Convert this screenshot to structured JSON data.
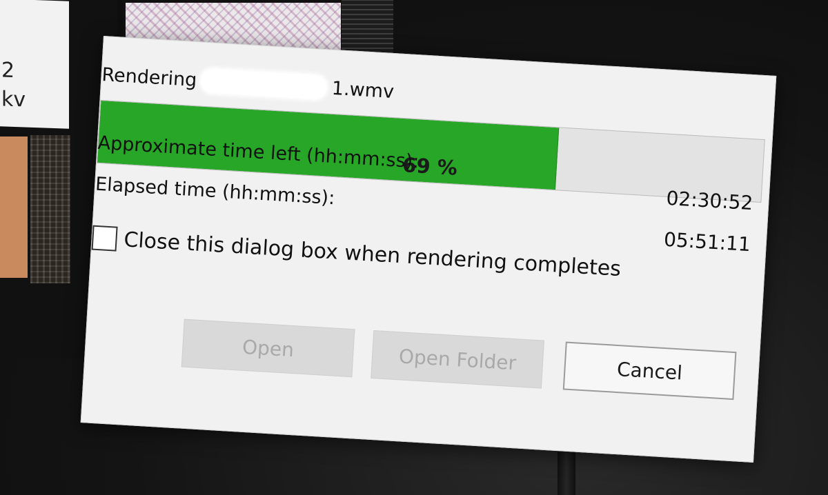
{
  "dialog": {
    "title_prefix": "Rendering",
    "title_suffix": "1.wmv"
  },
  "progress": {
    "percent": 69,
    "label": "69 %",
    "fill_color": "#28a628"
  },
  "time_remaining": {
    "label": "Approximate time left (hh:mm:ss):",
    "value": "02:30:52"
  },
  "time_elapsed": {
    "label": "Elapsed time (hh:mm:ss):",
    "value": "05:51:11"
  },
  "close_option": {
    "label": "Close this dialog box when rendering completes",
    "checked": false
  },
  "buttons": {
    "open": "Open",
    "open_folder": "Open Folder",
    "cancel": "Cancel"
  },
  "background": {
    "thumb_text_line1": "2",
    "thumb_text_line2": "kv"
  }
}
